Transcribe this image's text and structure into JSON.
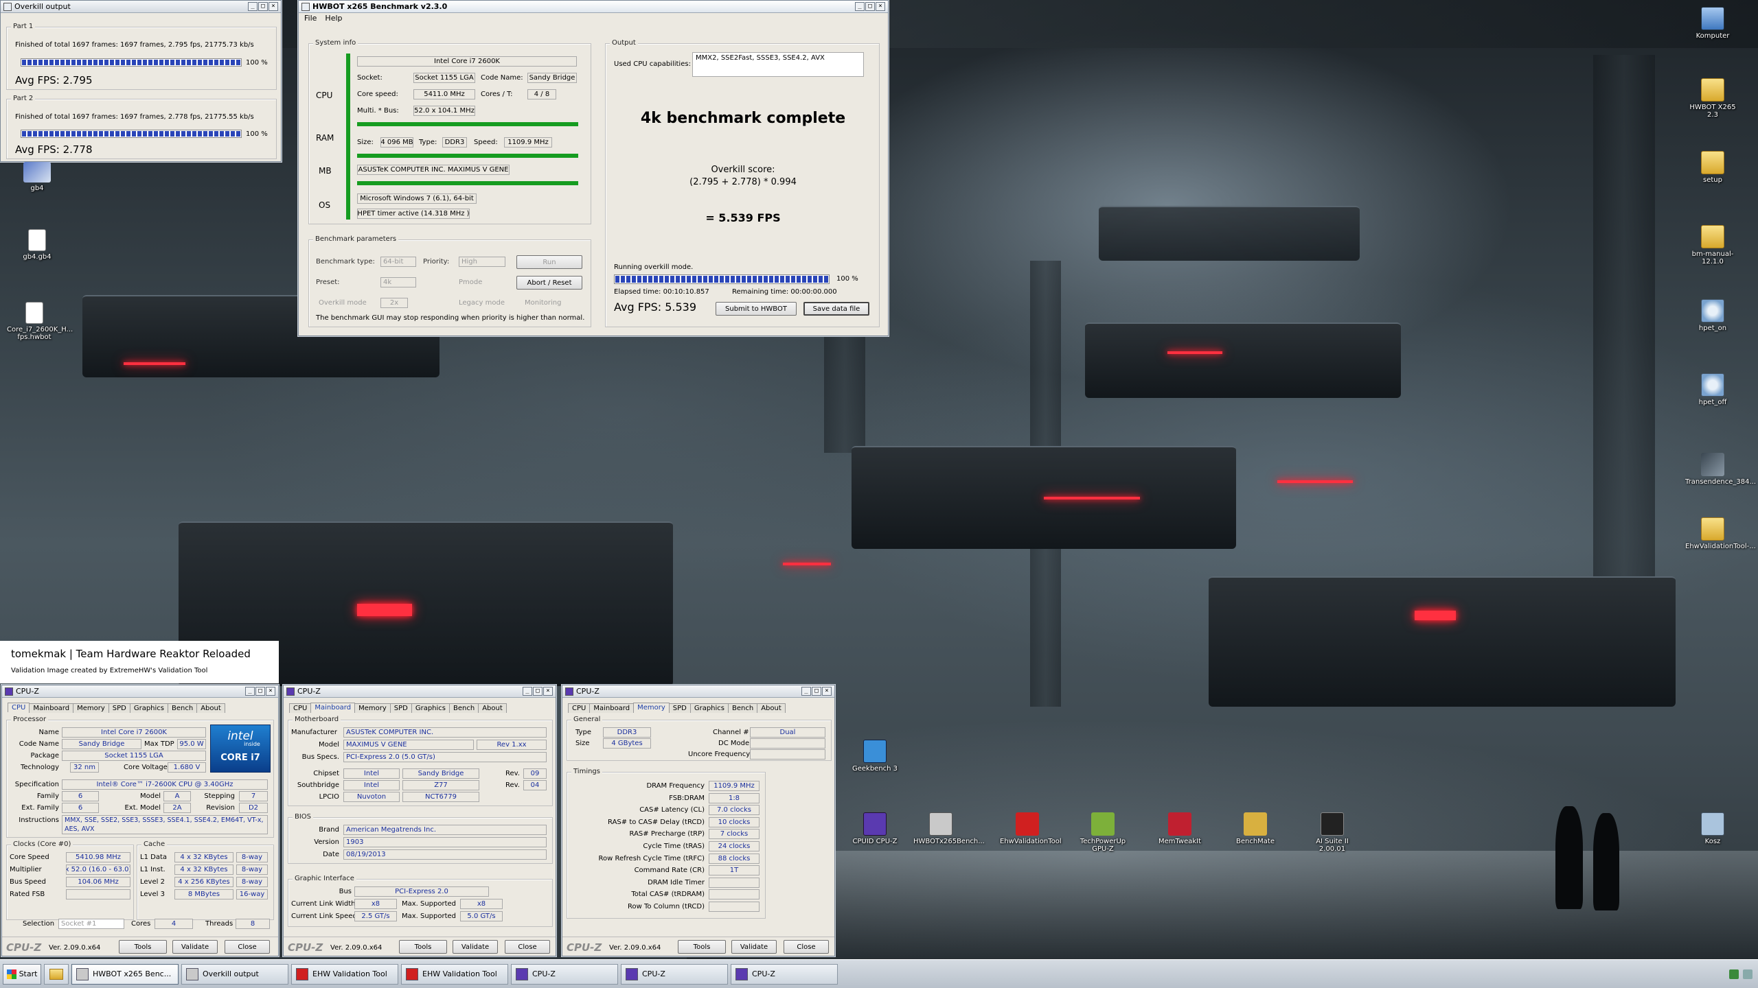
{
  "overkill_window": {
    "title": "Overkill output",
    "part1": {
      "label": "Part 1",
      "status": "Finished of total 1697 frames: 1697 frames, 2.795 fps,  21775.73 kb/s",
      "progress": 1.0,
      "percent": "100 %",
      "avg": "Avg FPS: 2.795"
    },
    "part2": {
      "label": "Part 2",
      "status": "Finished of total 1697 frames: 1697 frames, 2.778 fps,  21775.55 kb/s",
      "progress": 1.0,
      "percent": "100 %",
      "avg": "Avg FPS: 2.778"
    }
  },
  "hwbot_window": {
    "title": "HWBOT x265 Benchmark v2.3.0",
    "menu": [
      "File",
      "Help"
    ],
    "sysinfo": {
      "group": "System info",
      "cpu_label": "CPU",
      "ram_label": "RAM",
      "mb_label": "MB",
      "os_label": "OS",
      "cpu_name": "Intel Core i7 2600K",
      "socket_label": "Socket:",
      "socket": "Socket 1155 LGA",
      "codename_label": "Code Name:",
      "codename": "Sandy Bridge",
      "corespeed_label": "Core speed:",
      "corespeed": "5411.0 MHz",
      "cores_label": "Cores / T:",
      "cores": "4 / 8",
      "mult_label": "Multi. * Bus:",
      "mult": "52.0 x 104.1 MHz",
      "size_label": "Size:",
      "size": "4 096 MB",
      "type_label": "Type:",
      "type": "DDR3",
      "speed_label": "Speed:",
      "speed": "1109.9 MHz",
      "mb": "ASUSTeK COMPUTER INC. MAXIMUS V GENE",
      "os": "Microsoft Windows 7 (6.1), 64-bit",
      "timer": "HPET timer active (14.318 MHz )"
    },
    "params": {
      "group": "Benchmark parameters",
      "type_label": "Benchmark type:",
      "type": "64-bit",
      "priority_label": "Priority:",
      "priority": "High",
      "run": "Run",
      "preset_label": "Preset:",
      "preset": "4k",
      "pmode": "Pmode",
      "abort": "Abort / Reset",
      "overkill": "Overkill mode",
      "overkill_val": "2x",
      "legacy": "Legacy mode",
      "monitoring": "Monitoring",
      "note": "The benchmark GUI may stop responding when priority is higher than normal."
    },
    "output": {
      "group": "Output",
      "caps_label": "Used CPU capabilities:",
      "caps": "MMX2, SSE2Fast, SSSE3, SSE4.2, AVX",
      "headline": "4k benchmark complete",
      "score_label": "Overkill score:",
      "formula": "(2.795 + 2.778) * 0.994",
      "result": "= 5.539 FPS",
      "running": "Running overkill mode.",
      "progress": 1.0,
      "percent": "100 %",
      "elapsed": "Elapsed time: 00:10:10.857",
      "remaining": "Remaining time: 00:00:00.000",
      "avg": "Avg FPS: 5.539",
      "submit": "Submit to HWBOT",
      "save": "Save data file"
    }
  },
  "desktop_left": [
    {
      "label": "gb4",
      "icon": "image-icon"
    },
    {
      "label": "gb4.gb4",
      "icon": "file-icon"
    },
    {
      "label": "Core_i7_2600K_H...\nfps.hwbot",
      "icon": "file-icon"
    }
  ],
  "desktop_right": [
    {
      "label": "Komputer",
      "icon": "computer-icon"
    },
    {
      "label": "HWBOT X265 2.3",
      "icon": "folder-icon"
    },
    {
      "label": "setup",
      "icon": "folder-icon"
    },
    {
      "label": "bm-manual-12.1.0",
      "icon": "folder-icon"
    },
    {
      "label": "hpet_on",
      "icon": "gear-icon"
    },
    {
      "label": "hpet_off",
      "icon": "gear-icon"
    },
    {
      "label": "Transendence_384...",
      "icon": "image-icon"
    },
    {
      "label": "EhwValidationTool-...",
      "icon": "folder-icon"
    }
  ],
  "desktop_apps": [
    {
      "label": "Geekbench 3",
      "color": "#3a8fd8"
    },
    {
      "label": "CPUID CPU-Z",
      "color": "#5a3ab0"
    },
    {
      "label": "HWBOTx265Bench...",
      "color": "#c9c9c9"
    },
    {
      "label": "EhwValidationTool",
      "color": "#d02020"
    },
    {
      "label": "TechPowerUp GPU-Z",
      "color": "#7db03a"
    },
    {
      "label": "MemTweakIt",
      "color": "#c02030"
    },
    {
      "label": "BenchMate",
      "color": "#d8b040"
    },
    {
      "label": "AI Suite II 2.00.01",
      "color": "#222222"
    },
    {
      "label": "Kosz",
      "color": "#aac4dd"
    }
  ],
  "watermark": {
    "line1": "tomekmak | Team Hardware Reaktor Reloaded",
    "line2": "Validation Image created by ExtremeHW's Validation Tool"
  },
  "cpuz1": {
    "title": "CPU-Z",
    "tabs": [
      "CPU",
      "Mainboard",
      "Memory",
      "SPD",
      "Graphics",
      "Bench",
      "About"
    ],
    "active_tab": 0,
    "processor": "Processor",
    "name_l": "Name",
    "name": "Intel Core i7 2600K",
    "codename_l": "Code Name",
    "codename": "Sandy Bridge",
    "tdp_l": "Max TDP",
    "tdp": "95.0 W",
    "package_l": "Package",
    "package": "Socket 1155 LGA",
    "tech_l": "Technology",
    "tech": "32 nm",
    "volt_l": "Core Voltage",
    "volt": "1.680 V",
    "spec_l": "Specification",
    "spec": "Intel® Core™ i7-2600K CPU @ 3.40GHz",
    "family_l": "Family",
    "family": "6",
    "model_l": "Model",
    "model": "A",
    "stepping_l": "Stepping",
    "stepping": "7",
    "extfam_l": "Ext. Family",
    "extfam": "6",
    "extmodel_l": "Ext. Model",
    "extmodel": "2A",
    "rev_l": "Revision",
    "rev": "D2",
    "instr_l": "Instructions",
    "instr": "MMX, SSE, SSE2, SSE3, SSSE3, SSE4.1, SSE4.2, EM64T, VT-x, AES, AVX",
    "clocks": "Clocks (Core #0)",
    "cache": "Cache",
    "corespeed_l": "Core Speed",
    "corespeed": "5410.98 MHz",
    "mult_l": "Multiplier",
    "mult": "x 52.0 (16.0 - 63.0)",
    "bus_l": "Bus Speed",
    "bus": "104.06 MHz",
    "fsb_l": "Rated FSB",
    "l1d_l": "L1 Data",
    "l1d": "4 x 32 KBytes",
    "l1d_w": "8-way",
    "l1i_l": "L1 Inst.",
    "l1i": "4 x 32 KBytes",
    "l1i_w": "8-way",
    "l2_l": "Level 2",
    "l2": "4 x 256 KBytes",
    "l2_w": "8-way",
    "l3_l": "Level 3",
    "l3": "8 MBytes",
    "l3_w": "16-way",
    "sel_l": "Selection",
    "sel": "Socket #1",
    "cores_l": "Cores",
    "cores": "4",
    "threads_l": "Threads",
    "threads": "8",
    "intel_badge_top": "intel",
    "intel_badge_inside": "inside",
    "intel_badge_bottom": "CORE i7"
  },
  "cpuz2": {
    "title": "CPU-Z",
    "tabs": [
      "CPU",
      "Mainboard",
      "Memory",
      "SPD",
      "Graphics",
      "Bench",
      "About"
    ],
    "active_tab": 1,
    "motherboard": "Motherboard",
    "manu_l": "Manufacturer",
    "manu": "ASUSTeK COMPUTER INC.",
    "model_l": "Model",
    "model": "MAXIMUS V GENE",
    "model_rev": "Rev 1.xx",
    "bus_l": "Bus Specs.",
    "bus": "PCI-Express 2.0 (5.0 GT/s)",
    "chipset_l": "Chipset",
    "chipset": "Intel",
    "chipset2": "Sandy Bridge",
    "chipset_rev_l": "Rev.",
    "chipset_rev": "09",
    "south_l": "Southbridge",
    "south": "Intel",
    "south2": "Z77",
    "south_rev_l": "Rev.",
    "south_rev": "04",
    "lpcio_l": "LPCIO",
    "lpcio": "Nuvoton",
    "lpcio2": "NCT6779",
    "bios": "BIOS",
    "brand_l": "Brand",
    "brand": "American Megatrends Inc.",
    "version_l": "Version",
    "version": "1903",
    "date_l": "Date",
    "date": "08/19/2013",
    "gi": "Graphic Interface",
    "gbus_l": "Bus",
    "gbus": "PCI-Express 2.0",
    "clw_l": "Current Link Width",
    "clw": "x8",
    "msw_l": "Max. Supported",
    "msw": "x8",
    "cls_l": "Current Link Speed",
    "cls": "2.5 GT/s",
    "mss_l": "Max. Supported",
    "mss": "5.0 GT/s"
  },
  "cpuz3": {
    "title": "CPU-Z",
    "tabs": [
      "CPU",
      "Mainboard",
      "Memory",
      "SPD",
      "Graphics",
      "Bench",
      "About"
    ],
    "active_tab": 2,
    "general": "General",
    "type_l": "Type",
    "type": "DDR3",
    "channel_l": "Channel #",
    "channel": "Dual",
    "size_l": "Size",
    "size": "4 GBytes",
    "dcmode_l": "DC Mode",
    "uncore_l": "Uncore Frequency",
    "timings": "Timings",
    "rows": [
      {
        "l": "DRAM Frequency",
        "v": "1109.9 MHz",
        "dis": false
      },
      {
        "l": "FSB:DRAM",
        "v": "1:8",
        "dis": false
      },
      {
        "l": "CAS# Latency (CL)",
        "v": "7.0 clocks",
        "dis": false
      },
      {
        "l": "RAS# to CAS# Delay (tRCD)",
        "v": "10 clocks",
        "dis": false
      },
      {
        "l": "RAS# Precharge (tRP)",
        "v": "7 clocks",
        "dis": false
      },
      {
        "l": "Cycle Time (tRAS)",
        "v": "24 clocks",
        "dis": false
      },
      {
        "l": "Row Refresh Cycle Time (tRFC)",
        "v": "88 clocks",
        "dis": false
      },
      {
        "l": "Command Rate (CR)",
        "v": "1T",
        "dis": false
      },
      {
        "l": "DRAM Idle Timer",
        "v": "",
        "dis": true
      },
      {
        "l": "Total CAS# (tRDRAM)",
        "v": "",
        "dis": true
      },
      {
        "l": "Row To Column (tRCD)",
        "v": "",
        "dis": true
      }
    ]
  },
  "cpuz_footer": {
    "logo": "CPU-Z",
    "ver": "Ver. 2.09.0.x64",
    "tools": "Tools",
    "validate": "Validate",
    "close": "Close"
  },
  "taskbar": {
    "start": "Start",
    "buttons": [
      {
        "label": "HWBOT x265 Benc...",
        "active": true,
        "color": "#c9c9c9"
      },
      {
        "label": "Overkill output",
        "active": false,
        "color": "#c9c9c9"
      },
      {
        "label": "EHW Validation Tool",
        "active": false,
        "color": "#d02020"
      },
      {
        "label": "EHW Validation Tool",
        "active": false,
        "color": "#d02020"
      },
      {
        "label": "CPU-Z",
        "active": false,
        "color": "#5a3ab0"
      },
      {
        "label": "CPU-Z",
        "active": false,
        "color": "#5a3ab0"
      },
      {
        "label": "CPU-Z",
        "active": false,
        "color": "#5a3ab0"
      }
    ]
  }
}
